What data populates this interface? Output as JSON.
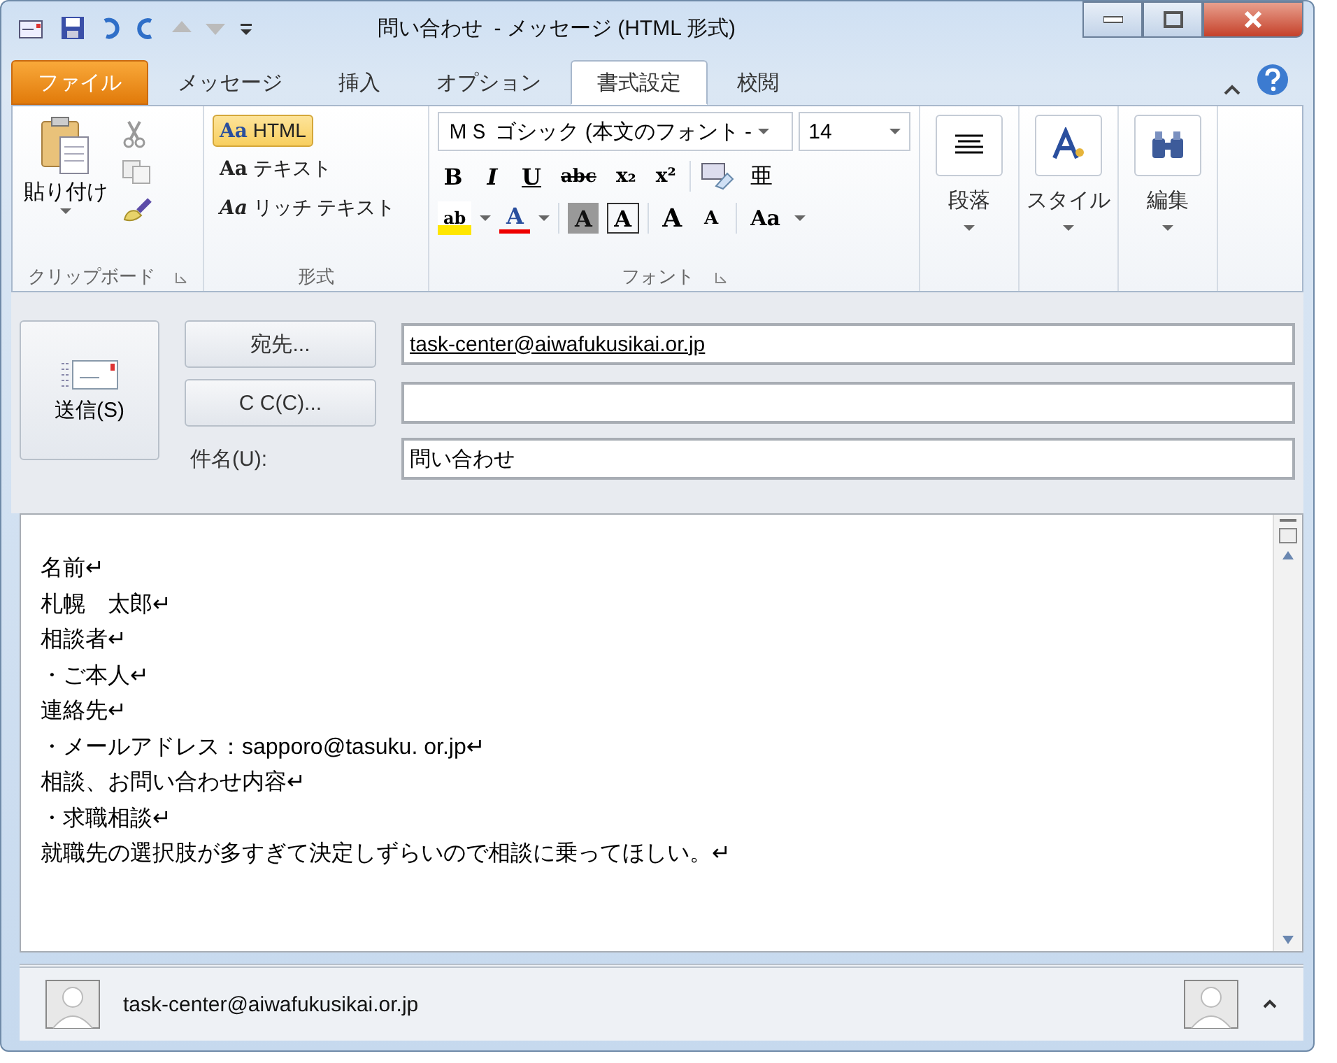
{
  "window": {
    "title": "問い合わせ  - メッセージ (HTML 形式)"
  },
  "tabs": [
    {
      "label": "ファイル",
      "kind": "file",
      "selected": false
    },
    {
      "label": "メッセージ",
      "kind": "tab",
      "selected": false
    },
    {
      "label": "挿入",
      "kind": "tab",
      "selected": false
    },
    {
      "label": "オプション",
      "kind": "tab",
      "selected": false
    },
    {
      "label": "書式設定",
      "kind": "tab",
      "selected": true
    },
    {
      "label": "校閲",
      "kind": "tab",
      "selected": false
    }
  ],
  "ribbon": {
    "clipboard": {
      "paste": "貼り付け",
      "label": "クリップボード"
    },
    "format": {
      "label": "形式",
      "options": [
        {
          "icon": "Aa",
          "label": "HTML",
          "selected": true
        },
        {
          "icon": "Aa",
          "label": "テキスト",
          "selected": false
        },
        {
          "icon": "Aa",
          "label": "リッチ テキスト",
          "selected": false
        }
      ]
    },
    "font": {
      "label": "フォント",
      "name": "ＭＳ ゴシック (本文のフォント -",
      "size": "14",
      "phonetic": "亜",
      "row1": [
        {
          "label": "B",
          "kind": "bold"
        },
        {
          "label": "I",
          "kind": "italic"
        },
        {
          "label": "U",
          "kind": "underline"
        },
        {
          "label": "abc",
          "kind": "strike"
        },
        {
          "label": "x₂",
          "kind": "plain"
        },
        {
          "label": "x²",
          "kind": "plain"
        }
      ],
      "row2": [
        {
          "label": "ab",
          "kind": "highlight"
        },
        {
          "label": "A",
          "kind": "fontcolor"
        },
        {
          "label": "A",
          "kind": "shaded"
        },
        {
          "label": "A",
          "kind": "boxed"
        },
        {
          "label": "A",
          "kind": "grow"
        },
        {
          "label": "A",
          "kind": "shrink"
        },
        {
          "label": "Aa",
          "kind": "case"
        }
      ]
    },
    "big": [
      {
        "label": "段落",
        "kind": "paragraph"
      },
      {
        "label": "スタイル",
        "kind": "style"
      },
      {
        "label": "編集",
        "kind": "edit"
      }
    ]
  },
  "compose": {
    "send": "送信(S)",
    "to_button": "宛先...",
    "to": "task-center@aiwafukusikai.or.jp",
    "cc_button": "C C(C)...",
    "subject_label": "件名(U):",
    "subject": "問い合わせ"
  },
  "body": [
    "名前↵",
    "札幌　太郎↵",
    "相談者↵",
    "・ご本人↵",
    "連絡先↵",
    "・メールアドレス：sapporo@tasuku. or.jp↵",
    "相談、お問い合わせ内容↵",
    "・求職相談↵",
    "就職先の選択肢が多すぎて決定しずらいので相談に乗ってほしい。↵"
  ],
  "people_pane": {
    "address": "task-center@aiwafukusikai.or.jp"
  }
}
